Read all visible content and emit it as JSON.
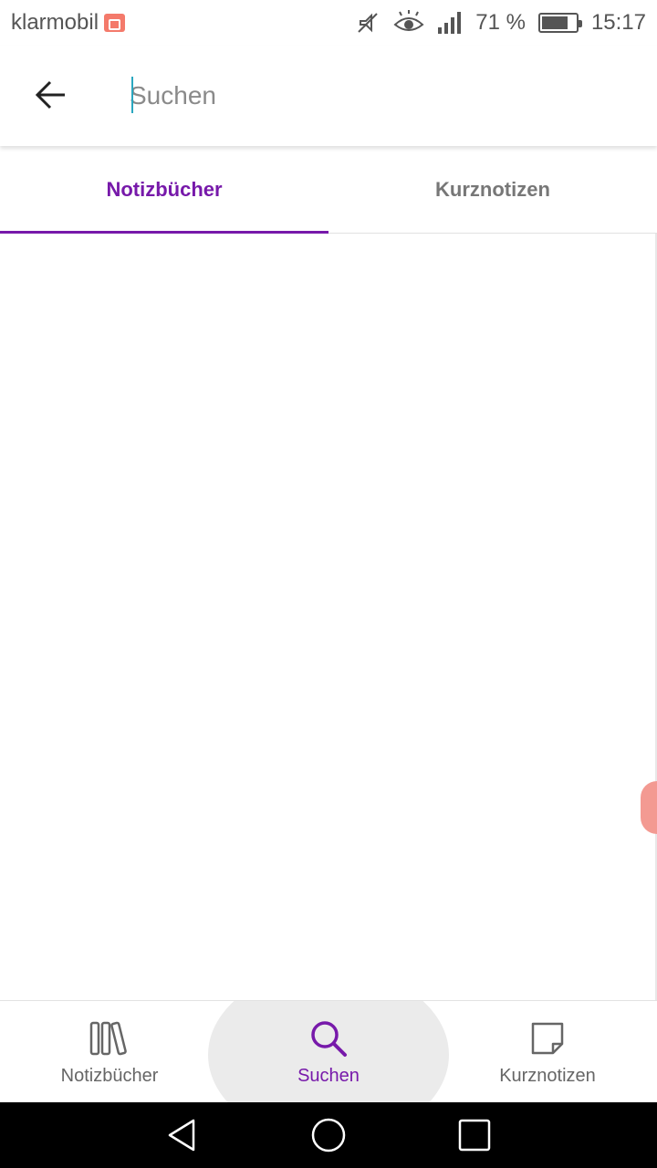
{
  "status_bar": {
    "carrier": "klarmobil",
    "battery_percent": "71 %",
    "battery_level": 0.71,
    "time": "15:17",
    "icons": [
      "camera-record-icon",
      "mute-icon",
      "eye-comfort-icon",
      "signal-icon",
      "battery-icon"
    ]
  },
  "search": {
    "placeholder": "Suchen",
    "value": ""
  },
  "tabs": [
    {
      "label": "Notizbücher",
      "active": true
    },
    {
      "label": "Kurznotizen",
      "active": false
    }
  ],
  "bottom_nav": [
    {
      "label": "Notizbücher",
      "icon": "notebooks-icon",
      "active": false
    },
    {
      "label": "Suchen",
      "icon": "search-icon",
      "active": true
    },
    {
      "label": "Kurznotizen",
      "icon": "sticky-note-icon",
      "active": false
    }
  ],
  "colors": {
    "accent": "#7719aa",
    "caret": "#2aa7c0",
    "edge_handle": "#f39a92"
  }
}
